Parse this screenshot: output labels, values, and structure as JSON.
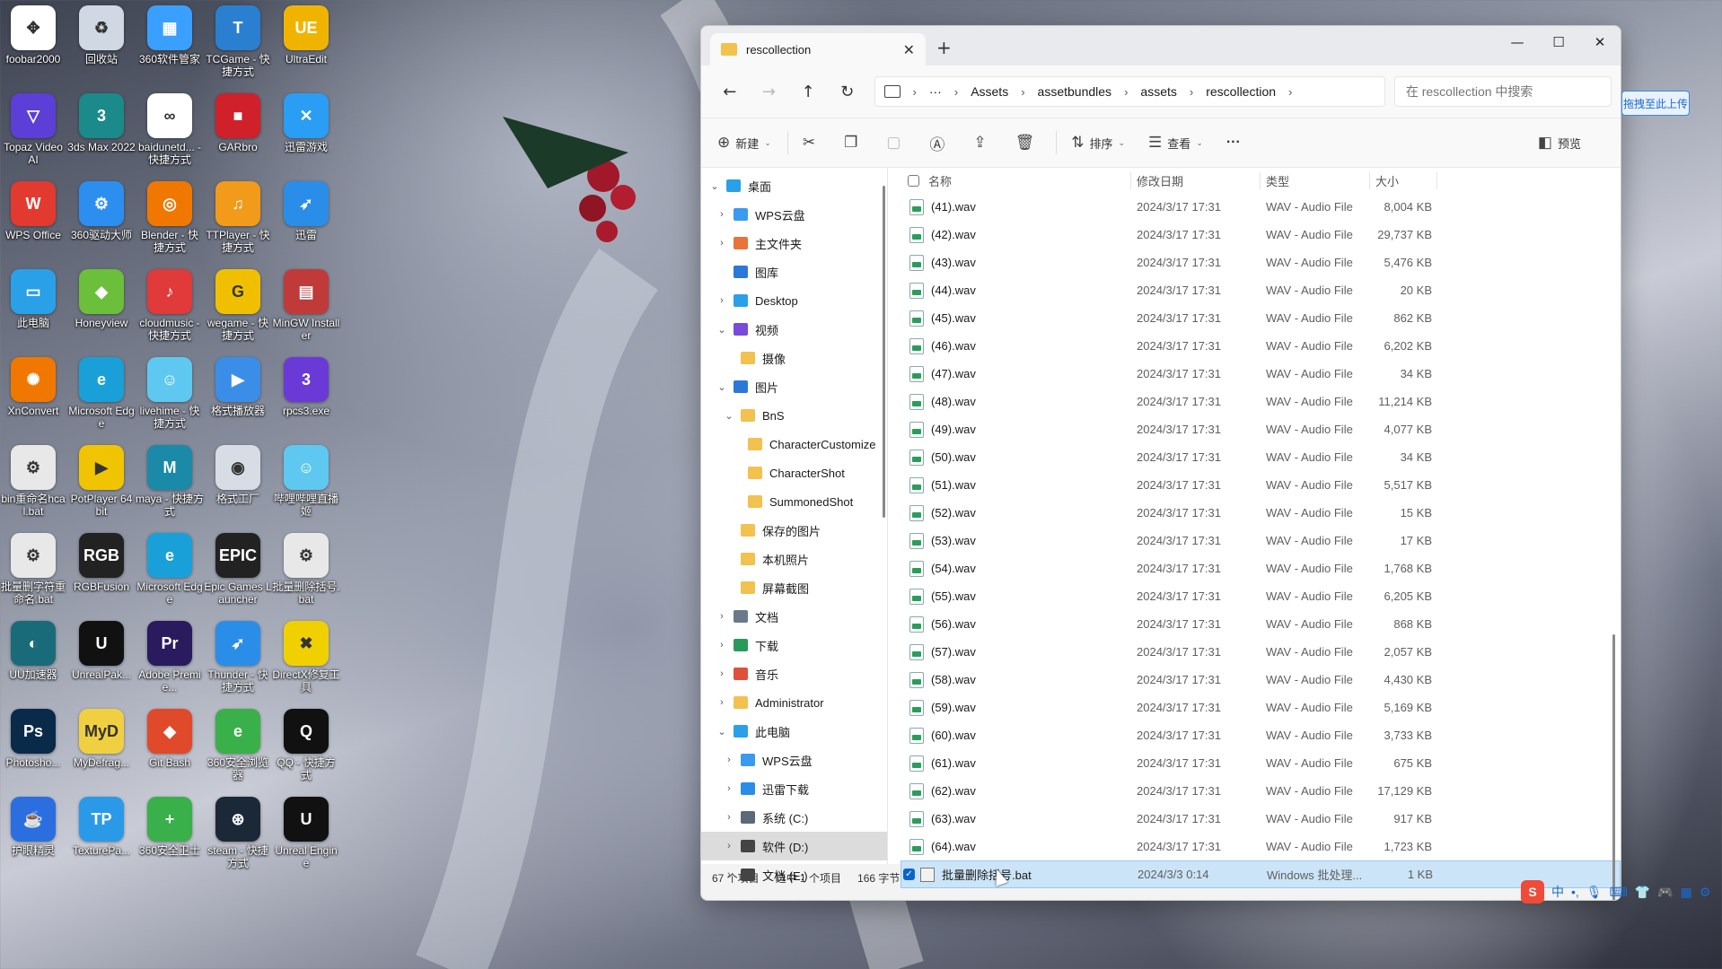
{
  "desktop_icons": [
    {
      "label": "foobar2000",
      "icon": "cross-arrows-icon",
      "color": "#ffffff",
      "glyph": "✥"
    },
    {
      "label": "回收站",
      "icon": "recycle-bin-icon",
      "color": "#cfd8e3",
      "glyph": "♻"
    },
    {
      "label": "360软件管家",
      "icon": "colorful-grid-icon",
      "color": "#3aa0ff",
      "glyph": "▦"
    },
    {
      "label": "TCGame - 快捷方式",
      "icon": "tcgame-icon",
      "color": "#2a7fd0",
      "glyph": "T"
    },
    {
      "label": "UltraEdit",
      "icon": "ultraedit-icon",
      "color": "#f0b400",
      "glyph": "UE"
    },
    {
      "label": "Topaz Video AI",
      "icon": "topaz-icon",
      "color": "#5b3fd6",
      "glyph": "▽"
    },
    {
      "label": "3ds Max 2022",
      "icon": "3dsmax-icon",
      "color": "#1b8a8a",
      "glyph": "3"
    },
    {
      "label": "baidunetd... - 快捷方式",
      "icon": "baidu-netdisk-icon",
      "color": "#ffffff",
      "glyph": "∞"
    },
    {
      "label": "GARbro",
      "icon": "garbro-icon",
      "color": "#d0202a",
      "glyph": "■"
    },
    {
      "label": "迅雷游戏",
      "icon": "xunlei-game-icon",
      "color": "#2a9df4",
      "glyph": "✕"
    },
    {
      "label": "WPS Office",
      "icon": "wps-icon",
      "color": "#e23a2f",
      "glyph": "W"
    },
    {
      "label": "360驱动大师",
      "icon": "360-driver-icon",
      "color": "#2c8ff0",
      "glyph": "⚙"
    },
    {
      "label": "Blender - 快捷方式",
      "icon": "blender-icon",
      "color": "#f07800",
      "glyph": "◎"
    },
    {
      "label": "TTPlayer - 快捷方式",
      "icon": "ttplayer-icon",
      "color": "#f29a1a",
      "glyph": "♫"
    },
    {
      "label": "迅雷",
      "icon": "xunlei-icon",
      "color": "#2a8ee8",
      "glyph": "➶"
    },
    {
      "label": "此电脑",
      "icon": "this-pc-icon",
      "color": "#2aa0e8",
      "glyph": "▭"
    },
    {
      "label": "Honeyview",
      "icon": "honeyview-icon",
      "color": "#6bbf3a",
      "glyph": "◆"
    },
    {
      "label": "cloudmusic - 快捷方式",
      "icon": "netease-music-icon",
      "color": "#e03a3a",
      "glyph": "♪"
    },
    {
      "label": "wegame - 快捷方式",
      "icon": "wegame-icon",
      "color": "#f0c000",
      "glyph": "G"
    },
    {
      "label": "MinGW Installer",
      "icon": "mingw-icon",
      "color": "#c03a3a",
      "glyph": "▤"
    },
    {
      "label": "XnConvert",
      "icon": "xnconvert-icon",
      "color": "#f07800",
      "glyph": "✺"
    },
    {
      "label": "Microsoft Edge",
      "icon": "edge-icon",
      "color": "#1aa0d8",
      "glyph": "e"
    },
    {
      "label": "livehime - 快捷方式",
      "icon": "livehime-icon",
      "color": "#5ec8f0",
      "glyph": "☺"
    },
    {
      "label": "格式播放器",
      "icon": "video-player-icon",
      "color": "#3a8ee8",
      "glyph": "▶"
    },
    {
      "label": "rpcs3.exe",
      "icon": "rpcs3-icon",
      "color": "#6b3ad6",
      "glyph": "3"
    },
    {
      "label": "bin重命名hcal.bat",
      "icon": "bat-gear-icon",
      "color": "#e8e8e8",
      "glyph": "⚙"
    },
    {
      "label": "PotPlayer 64 bit",
      "icon": "potplayer-icon",
      "color": "#f0c400",
      "glyph": "▶"
    },
    {
      "label": "maya - 快捷方式",
      "icon": "maya-icon",
      "color": "#1a8aa8",
      "glyph": "M"
    },
    {
      "label": "格式工厂",
      "icon": "format-factory-icon",
      "color": "#d8dde5",
      "glyph": "◉"
    },
    {
      "label": "哔哩哔哩直播姬",
      "icon": "bilibili-live-icon",
      "color": "#5ec8f0",
      "glyph": "☺"
    },
    {
      "label": "批量删字符重命名.bat",
      "icon": "bat-gear-icon",
      "color": "#e8e8e8",
      "glyph": "⚙"
    },
    {
      "label": "RGBFusion",
      "icon": "rgbfusion-icon",
      "color": "#222222",
      "glyph": "RGB"
    },
    {
      "label": "Microsoft Edge",
      "icon": "edge-icon",
      "color": "#1aa0d8",
      "glyph": "e"
    },
    {
      "label": "Epic Games Launcher",
      "icon": "epic-icon",
      "color": "#222222",
      "glyph": "EPIC"
    },
    {
      "label": "批量删除括号.bat",
      "icon": "bat-gear-icon",
      "color": "#e8e8e8",
      "glyph": "⚙"
    },
    {
      "label": "UU加速器",
      "icon": "uu-icon",
      "color": "#1a6b7a",
      "glyph": "◐"
    },
    {
      "label": "UnrealPak...",
      "icon": "unreal-icon",
      "color": "#111111",
      "glyph": "U"
    },
    {
      "label": "Adobe Premie...",
      "icon": "premiere-icon",
      "color": "#2a1a5e",
      "glyph": "Pr"
    },
    {
      "label": "Thunder - 快捷方式",
      "icon": "thunder-icon",
      "color": "#2a8ee8",
      "glyph": "➶"
    },
    {
      "label": "DirectX修复工具",
      "icon": "directx-icon",
      "color": "#f0d000",
      "glyph": "✖"
    },
    {
      "label": "Photosho...",
      "icon": "photoshop-icon",
      "color": "#0a2a4a",
      "glyph": "Ps"
    },
    {
      "label": "MyDefrag...",
      "icon": "mydefrag-icon",
      "color": "#f0d040",
      "glyph": "MyD"
    },
    {
      "label": "Git Bash",
      "icon": "git-bash-icon",
      "color": "#e04a2a",
      "glyph": "◆"
    },
    {
      "label": "360安全浏览器",
      "icon": "360-browser-icon",
      "color": "#3ab04a",
      "glyph": "e"
    },
    {
      "label": "QQ - 快捷方式",
      "icon": "qq-icon",
      "color": "#111111",
      "glyph": "Q"
    },
    {
      "label": "护眼精灵",
      "icon": "eye-care-icon",
      "color": "#2a6ee0",
      "glyph": "☕"
    },
    {
      "label": "TexturePa...",
      "icon": "texturepacker-icon",
      "color": "#2a9ae8",
      "glyph": "TP"
    },
    {
      "label": "360安全卫士",
      "icon": "360-security-icon",
      "color": "#3ab04a",
      "glyph": "+"
    },
    {
      "label": "steam - 快捷方式",
      "icon": "steam-icon",
      "color": "#1b2838",
      "glyph": "⊛"
    },
    {
      "label": "Unreal Engine",
      "icon": "unreal-engine-icon",
      "color": "#111111",
      "glyph": "U"
    }
  ],
  "window": {
    "tab_title": "rescollection",
    "tab_close": "✕",
    "new_tab": "+",
    "controls": {
      "minimize": "—",
      "maximize": "☐",
      "close": "✕"
    },
    "nav": {
      "back": "←",
      "forward": "→",
      "up": "↑",
      "refresh": "↻"
    },
    "breadcrumb": {
      "more": "···",
      "parts": [
        "Assets",
        "assetbundles",
        "assets",
        "rescollection"
      ]
    },
    "search_placeholder": "在 rescollection 中搜索"
  },
  "toolbar": {
    "new_label": "新建",
    "sort_label": "排序",
    "view_label": "查看",
    "more": "···",
    "preview_label": "预览"
  },
  "nav_pane": [
    {
      "label": "桌面",
      "indent": 0,
      "chev": "⌄",
      "icon": "desktop-icon",
      "color": "#2aa0e8"
    },
    {
      "label": "WPS云盘",
      "indent": 1,
      "chev": "›",
      "icon": "cloud-icon",
      "color": "#3a9af0"
    },
    {
      "label": "主文件夹",
      "indent": 1,
      "chev": "›",
      "icon": "home-icon",
      "color": "#e8743a"
    },
    {
      "label": "图库",
      "indent": 1,
      "chev": "",
      "icon": "gallery-icon",
      "color": "#2a78d8"
    },
    {
      "label": "Desktop",
      "indent": 1,
      "chev": "›",
      "icon": "desktop-folder-icon",
      "color": "#2aa0e8"
    },
    {
      "label": "视频",
      "indent": 1,
      "chev": "⌄",
      "icon": "video-folder-icon",
      "color": "#7a4ad8"
    },
    {
      "label": "摄像",
      "indent": 2,
      "chev": "",
      "icon": "folder-icon",
      "color": "#f2c14e"
    },
    {
      "label": "图片",
      "indent": 1,
      "chev": "⌄",
      "icon": "pictures-folder-icon",
      "color": "#2a78d8"
    },
    {
      "label": "BnS",
      "indent": 2,
      "chev": "⌄",
      "icon": "folder-icon",
      "color": "#f2c14e"
    },
    {
      "label": "CharacterCustomize",
      "indent": 3,
      "chev": "",
      "icon": "folder-icon",
      "color": "#f2c14e"
    },
    {
      "label": "CharacterShot",
      "indent": 3,
      "chev": "",
      "icon": "folder-icon",
      "color": "#f2c14e"
    },
    {
      "label": "SummonedShot",
      "indent": 3,
      "chev": "",
      "icon": "folder-icon",
      "color": "#f2c14e"
    },
    {
      "label": "保存的图片",
      "indent": 2,
      "chev": "",
      "icon": "folder-icon",
      "color": "#f2c14e"
    },
    {
      "label": "本机照片",
      "indent": 2,
      "chev": "",
      "icon": "folder-icon",
      "color": "#f2c14e"
    },
    {
      "label": "屏幕截图",
      "indent": 2,
      "chev": "",
      "icon": "folder-icon",
      "color": "#f2c14e"
    },
    {
      "label": "文档",
      "indent": 1,
      "chev": "›",
      "icon": "documents-icon",
      "color": "#6a7a8a"
    },
    {
      "label": "下载",
      "indent": 1,
      "chev": "›",
      "icon": "download-icon",
      "color": "#2a9a5a"
    },
    {
      "label": "音乐",
      "indent": 1,
      "chev": "›",
      "icon": "music-icon",
      "color": "#e0503a"
    },
    {
      "label": "Administrator",
      "indent": 1,
      "chev": "›",
      "icon": "folder-icon",
      "color": "#f2c14e"
    },
    {
      "label": "此电脑",
      "indent": 1,
      "chev": "⌄",
      "icon": "this-pc-icon",
      "color": "#2aa0e8"
    },
    {
      "label": "WPS云盘",
      "indent": 2,
      "chev": "›",
      "icon": "cloud-icon",
      "color": "#3a9af0"
    },
    {
      "label": "迅雷下载",
      "indent": 2,
      "chev": "›",
      "icon": "xunlei-icon",
      "color": "#2a8ee8"
    },
    {
      "label": "系统 (C:)",
      "indent": 2,
      "chev": "›",
      "icon": "system-drive-icon",
      "color": "#5a6a7a"
    },
    {
      "label": "软件 (D:)",
      "indent": 2,
      "chev": "›",
      "icon": "drive-icon",
      "color": "#444444",
      "selected": true
    },
    {
      "label": "文档 (E:)",
      "indent": 2,
      "chev": "›",
      "icon": "drive-icon",
      "color": "#444444"
    }
  ],
  "columns": {
    "name": "名称",
    "date": "修改日期",
    "type": "类型",
    "size": "大小"
  },
  "files": [
    {
      "name": "(41).wav",
      "date": "2024/3/17 17:31",
      "type": "WAV - Audio File",
      "size": "8,004 KB"
    },
    {
      "name": "(42).wav",
      "date": "2024/3/17 17:31",
      "type": "WAV - Audio File",
      "size": "29,737 KB"
    },
    {
      "name": "(43).wav",
      "date": "2024/3/17 17:31",
      "type": "WAV - Audio File",
      "size": "5,476 KB"
    },
    {
      "name": "(44).wav",
      "date": "2024/3/17 17:31",
      "type": "WAV - Audio File",
      "size": "20 KB"
    },
    {
      "name": "(45).wav",
      "date": "2024/3/17 17:31",
      "type": "WAV - Audio File",
      "size": "862 KB"
    },
    {
      "name": "(46).wav",
      "date": "2024/3/17 17:31",
      "type": "WAV - Audio File",
      "size": "6,202 KB"
    },
    {
      "name": "(47).wav",
      "date": "2024/3/17 17:31",
      "type": "WAV - Audio File",
      "size": "34 KB"
    },
    {
      "name": "(48).wav",
      "date": "2024/3/17 17:31",
      "type": "WAV - Audio File",
      "size": "11,214 KB"
    },
    {
      "name": "(49).wav",
      "date": "2024/3/17 17:31",
      "type": "WAV - Audio File",
      "size": "4,077 KB"
    },
    {
      "name": "(50).wav",
      "date": "2024/3/17 17:31",
      "type": "WAV - Audio File",
      "size": "34 KB"
    },
    {
      "name": "(51).wav",
      "date": "2024/3/17 17:31",
      "type": "WAV - Audio File",
      "size": "5,517 KB"
    },
    {
      "name": "(52).wav",
      "date": "2024/3/17 17:31",
      "type": "WAV - Audio File",
      "size": "15 KB"
    },
    {
      "name": "(53).wav",
      "date": "2024/3/17 17:31",
      "type": "WAV - Audio File",
      "size": "17 KB"
    },
    {
      "name": "(54).wav",
      "date": "2024/3/17 17:31",
      "type": "WAV - Audio File",
      "size": "1,768 KB"
    },
    {
      "name": "(55).wav",
      "date": "2024/3/17 17:31",
      "type": "WAV - Audio File",
      "size": "6,205 KB"
    },
    {
      "name": "(56).wav",
      "date": "2024/3/17 17:31",
      "type": "WAV - Audio File",
      "size": "868 KB"
    },
    {
      "name": "(57).wav",
      "date": "2024/3/17 17:31",
      "type": "WAV - Audio File",
      "size": "2,057 KB"
    },
    {
      "name": "(58).wav",
      "date": "2024/3/17 17:31",
      "type": "WAV - Audio File",
      "size": "4,430 KB"
    },
    {
      "name": "(59).wav",
      "date": "2024/3/17 17:31",
      "type": "WAV - Audio File",
      "size": "5,169 KB"
    },
    {
      "name": "(60).wav",
      "date": "2024/3/17 17:31",
      "type": "WAV - Audio File",
      "size": "3,733 KB"
    },
    {
      "name": "(61).wav",
      "date": "2024/3/17 17:31",
      "type": "WAV - Audio File",
      "size": "675 KB"
    },
    {
      "name": "(62).wav",
      "date": "2024/3/17 17:31",
      "type": "WAV - Audio File",
      "size": "17,129 KB"
    },
    {
      "name": "(63).wav",
      "date": "2024/3/17 17:31",
      "type": "WAV - Audio File",
      "size": "917 KB"
    },
    {
      "name": "(64).wav",
      "date": "2024/3/17 17:31",
      "type": "WAV - Audio File",
      "size": "1,723 KB"
    }
  ],
  "selected_file": {
    "name": "批量删除括号.bat",
    "date": "2024/3/3 0:14",
    "type": "Windows 批处理...",
    "size": "1 KB"
  },
  "status": {
    "count": "67 个项目",
    "selected": "选中 1 个项目",
    "bytes": "166 字节"
  },
  "upload_button": "拖拽至此上传",
  "ime": {
    "logo": "S",
    "lang": "中"
  }
}
